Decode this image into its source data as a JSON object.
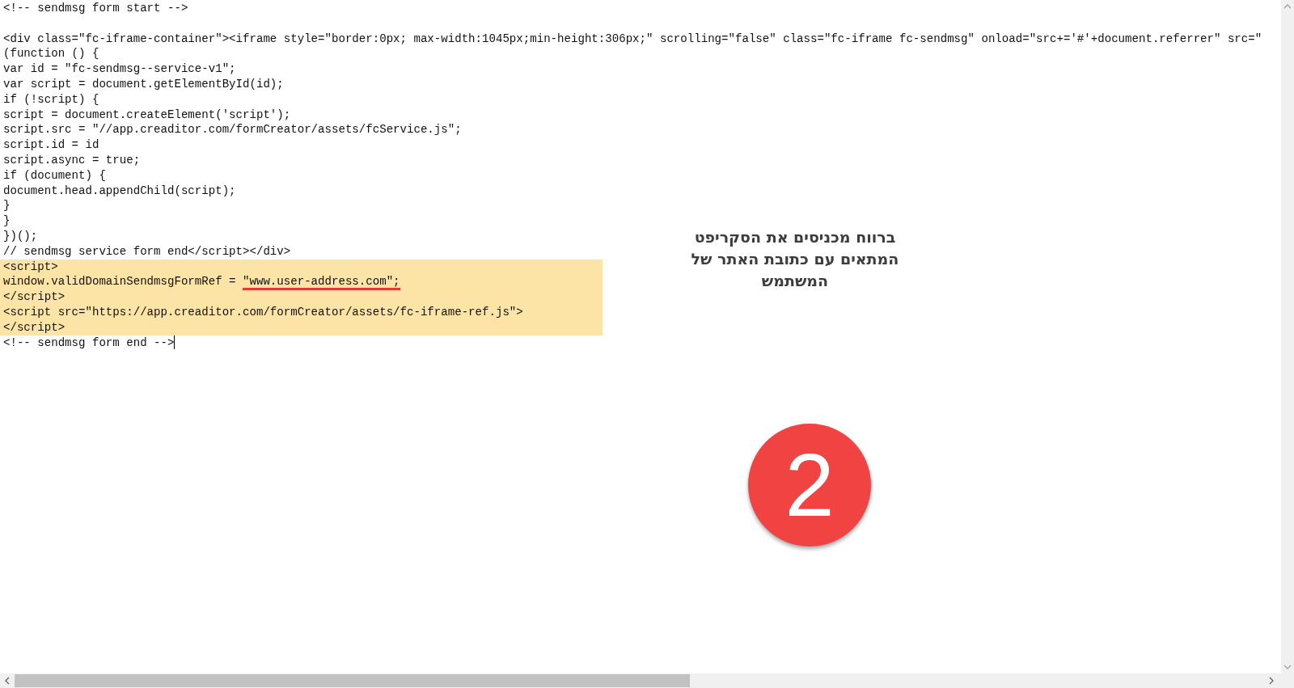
{
  "code_lines": [
    {
      "kind": "code",
      "text": "<!-- sendmsg form start -->",
      "highlighted": false
    },
    {
      "kind": "blank"
    },
    {
      "kind": "code",
      "text": "<div class=\"fc-iframe-container\"><iframe style=\"border:0px; max-width:1045px;min-height:306px;\" scrolling=\"false\" class=\"fc-iframe fc-sendmsg\" onload=\"src+='#'+document.referrer\" src=\"",
      "highlighted": false
    },
    {
      "kind": "code",
      "text": "(function () {",
      "highlighted": false
    },
    {
      "kind": "code",
      "text": "var id = \"fc-sendmsg--service-v1\";",
      "highlighted": false
    },
    {
      "kind": "code",
      "text": "var script = document.getElementById(id);",
      "highlighted": false
    },
    {
      "kind": "code",
      "text": "if (!script) {",
      "highlighted": false
    },
    {
      "kind": "code",
      "text": "script = document.createElement('script');",
      "highlighted": false
    },
    {
      "kind": "code",
      "text": "script.src = \"//app.creaditor.com/formCreator/assets/fcService.js\";",
      "highlighted": false
    },
    {
      "kind": "code",
      "text": "script.id = id",
      "highlighted": false
    },
    {
      "kind": "code",
      "text": "script.async = true;",
      "highlighted": false
    },
    {
      "kind": "code",
      "text": "if (document) {",
      "highlighted": false
    },
    {
      "kind": "code",
      "text": "document.head.appendChild(script);",
      "highlighted": false
    },
    {
      "kind": "code",
      "text": "}",
      "highlighted": false
    },
    {
      "kind": "code",
      "text": "}",
      "highlighted": false
    },
    {
      "kind": "code",
      "text": "})();",
      "highlighted": false
    },
    {
      "kind": "code",
      "text": "// sendmsg service form end</script></div>",
      "highlighted": false
    },
    {
      "kind": "code",
      "text": "<script>",
      "highlighted": true
    },
    {
      "kind": "parts",
      "highlighted": true,
      "parts": [
        {
          "text": "window.validDomainSendmsgFormRef = ",
          "underlined": false
        },
        {
          "text": "\"www.user-address.com\";",
          "underlined": true
        }
      ]
    },
    {
      "kind": "code",
      "text": "</script>",
      "highlighted": true
    },
    {
      "kind": "code",
      "text": "<script src=\"https://app.creaditor.com/formCreator/assets/fc-iframe-ref.js\">",
      "highlighted": true
    },
    {
      "kind": "code",
      "text": "</script>",
      "highlighted": true
    },
    {
      "kind": "code",
      "text": "<!-- sendmsg form end -->",
      "highlighted": false,
      "cursor": true
    }
  ],
  "annotation": {
    "text": "ברווח מכניסים את הסקריפט המתאים עם כתובת האתר של המשתמש"
  },
  "step_badge": {
    "number": "2"
  }
}
